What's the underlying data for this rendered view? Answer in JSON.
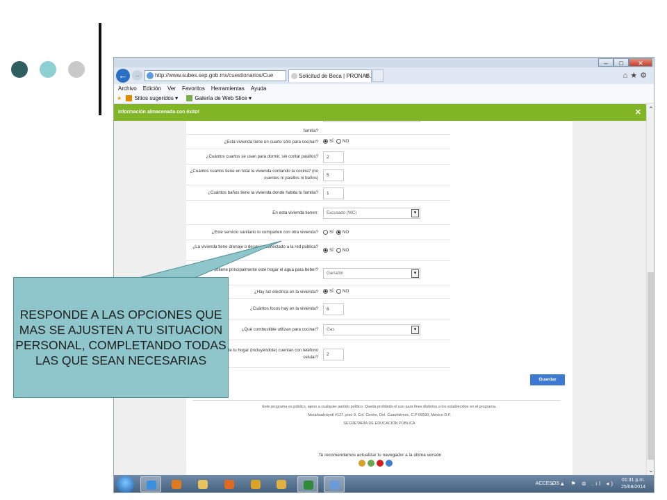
{
  "slide": {
    "dots": [
      {
        "name": "dark-teal-dot",
        "color": "#2f5f5f"
      },
      {
        "name": "light-teal-dot",
        "color": "#8ecfd4"
      },
      {
        "name": "grey-dot",
        "color": "#c9c9c9"
      }
    ]
  },
  "browser": {
    "window_buttons": {
      "minimize": "–",
      "maximize": "□",
      "close": "✕"
    },
    "back_glyph": "←",
    "forward_glyph": "→",
    "address": "http://www.subes.sep.gob.mx/cuestionarios/Cue",
    "address_tools": "⚲ ▾ ↻",
    "tab_title": "Solicitud de Beca | PRONAB...",
    "tab_close": "✕",
    "nav_icons": "⌂★⚙",
    "menu": [
      "Archivo",
      "Edición",
      "Ver",
      "Favoritos",
      "Herramientas",
      "Ayuda"
    ],
    "favorites": [
      "Sitios sugeridos ▾",
      "Galería de Web Slice ▾"
    ]
  },
  "notification": {
    "text": "Información almacenada con éxito!",
    "close": "✕"
  },
  "form": {
    "rows": [
      {
        "question": "familia?",
        "type": "cut"
      },
      {
        "question": "¿Esta vivienda tiene un cuarto sólo para cocinar?",
        "type": "radio",
        "options": [
          "SÍ",
          "NO"
        ],
        "selected": "SÍ"
      },
      {
        "question": "¿Cuántos cuartos se usan para dormir, sin contar pasillos?",
        "type": "number",
        "value": "2"
      },
      {
        "question": "¿Cuántos cuartos tiene en total la vivienda contando la cocina? (no cuentes ni pasillos ni baños)",
        "type": "number",
        "value": "5"
      },
      {
        "question": "¿Cuántos baños tiene la vivienda donde habita tu familia?",
        "type": "number",
        "value": "1"
      },
      {
        "question": "En esta vivienda tienen:",
        "type": "select",
        "value": "Excusado (WC)"
      },
      {
        "question": "¿Este servicio sanitario lo comparten con otra vivienda?",
        "type": "radio",
        "options": [
          "SÍ",
          "NO"
        ],
        "selected": "NO"
      },
      {
        "question": "¿La vivienda tiene drenaje o desagüe conectado a la red pública?",
        "type": "radio",
        "options": [
          "SÍ",
          "NO"
        ],
        "selected": "SÍ"
      },
      {
        "question": "¿De dónde obtiene principalmente este hogar el agua para beber?",
        "type": "select",
        "value": "Garrafón"
      },
      {
        "question": "¿Hay luz eléctrica en la vivienda?",
        "type": "radio",
        "options": [
          "SÍ",
          "NO"
        ],
        "selected": "SÍ"
      },
      {
        "question": "¿Cuántos focos hay en la vivienda?",
        "type": "number",
        "value": "6"
      },
      {
        "question": "¿Qué combustible utilizan para cocinar?",
        "type": "select",
        "value": "Gas"
      },
      {
        "question": "¿Cuántas personas de tu hogar (incluyéndote) cuentan con teléfono celular?",
        "type": "number",
        "value": "2"
      }
    ],
    "select_arrow": "▾",
    "save_label": "Guardar"
  },
  "footer": {
    "lines": [
      "Este programa es público, ajeno a cualquier partido político. Queda prohibido el uso para fines distintos a los establecidos en el programa.",
      "Nezahualcóyotl #127, piso 9, Col. Centro, Del. Cuauhtémoc, C.P 06590, México D.F.",
      "SECRETARÍA DE EDUCACIÓN PÚBLICA"
    ],
    "recommend": "Te recomendamos actualizar tu navegador a la última versión",
    "browser_icons": [
      {
        "name": "chrome-icon",
        "color": "#d9a02a"
      },
      {
        "name": "safari-icon",
        "color": "#6aa84f"
      },
      {
        "name": "opera-icon",
        "color": "#cc2222"
      },
      {
        "name": "ie-icon",
        "color": "#3f7fd0"
      }
    ]
  },
  "scrollbar": {
    "up": "⌃",
    "down": "⌄"
  },
  "taskbar": {
    "apps": [
      {
        "name": "ie-taskbar-icon",
        "color": "#3b8fe0",
        "active": true
      },
      {
        "name": "media-player-icon",
        "color": "#e07a20",
        "active": false
      },
      {
        "name": "explorer-folder-icon",
        "color": "#e8c25a",
        "active": false
      },
      {
        "name": "firefox-icon",
        "color": "#e06a20",
        "active": false
      },
      {
        "name": "chrome-taskbar-icon",
        "color": "#dba327",
        "active": false
      },
      {
        "name": "apps-grid-icon",
        "color": "#e0b040",
        "active": false
      },
      {
        "name": "excel-icon",
        "color": "#2f8a3a",
        "active": true
      },
      {
        "name": "paint-icon",
        "color": "#6a9ad8",
        "active": true
      }
    ],
    "accesos": "ACCESOS",
    "tray_glyphs": "» ▲ ⚑ ⊜ .ıl ◂)",
    "time": "01:31 p.m.",
    "date": "25/08/2014"
  },
  "callout": {
    "text": "RESPONDE A LAS OPCIONES QUE MAS SE AJUSTEN A TU SITUACION PERSONAL, COMPLETANDO TODAS LAS QUE SEAN NECESARIAS",
    "fill": "#8ec6cb"
  }
}
